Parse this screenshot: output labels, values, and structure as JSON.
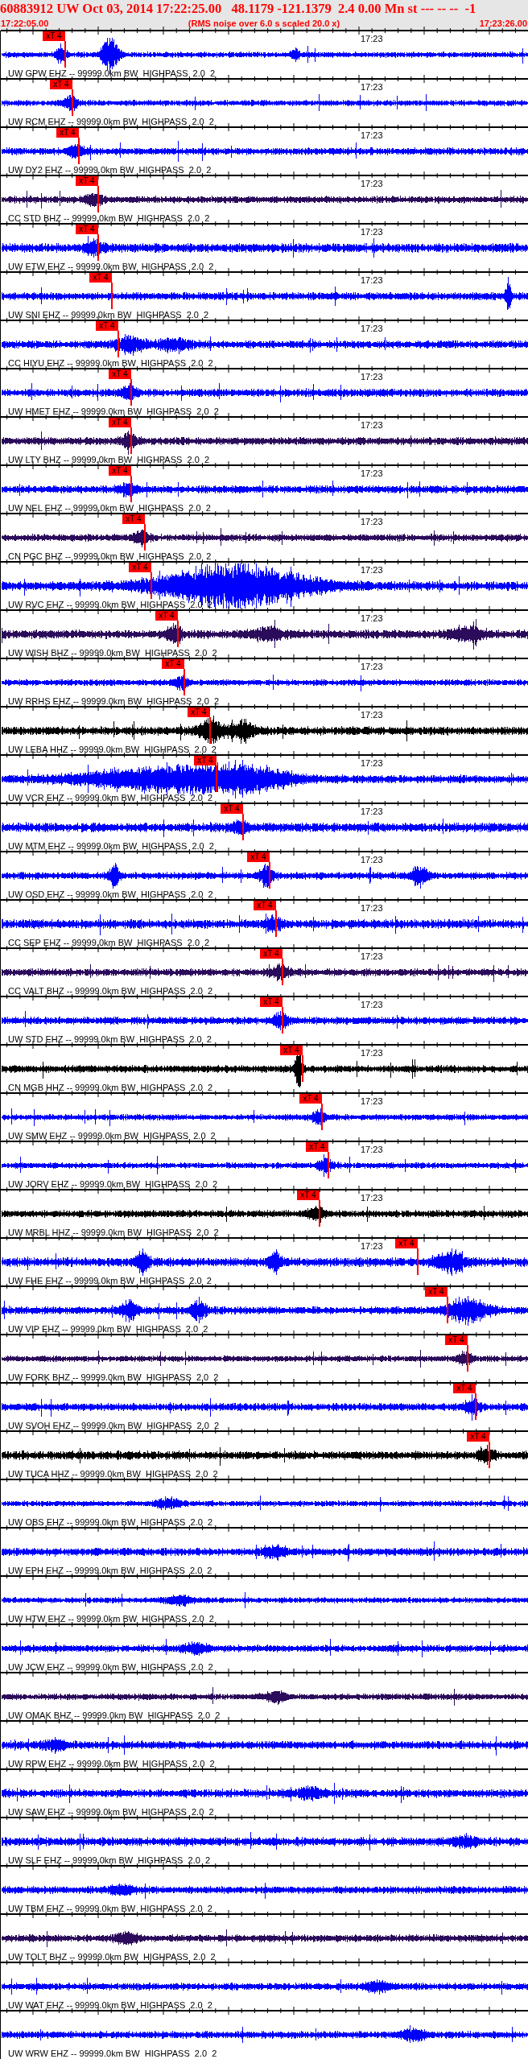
{
  "header": {
    "title": "60883912 UW Oct 03, 2014 17:22:25.00   48.1179 -121.1379  2.4 0.00 Mn st --- -- --  -1",
    "start_time": "17:22:05.00",
    "note": "(RMS noise over 6.0 s scaled 20.0 x)",
    "end_time": "17:23:26.00"
  },
  "channels": [
    {
      "label": "UW GPW EHZ -- 99999.0km BW  HIGHPASS  2.0  2",
      "color": "#0000ff",
      "time_mark": "17:23",
      "pick": "xT 4"
    },
    {
      "label": "UW RCM EHZ -- 99999.0km BW  HIGHPASS  2.0  2",
      "color": "#0000ff",
      "time_mark": "17:23",
      "pick": "xT 4"
    },
    {
      "label": "UW DY2 EHZ -- 99999.0km BW  HIGHPASS  2.0  2",
      "color": "#0000ff",
      "time_mark": "17:23",
      "pick": "xT 4"
    },
    {
      "label": "CC STD BHZ -- 99999.0km BW  HIGHPASS  2.0  2",
      "color": "#2b0b5b",
      "time_mark": "17:23",
      "pick": "xT 4"
    },
    {
      "label": "UW ETW EHZ -- 99999.0km BW  HIGHPASS  2.0  2",
      "color": "#0000ff",
      "time_mark": "17:23",
      "pick": "xT 4"
    },
    {
      "label": "UW SNI EHZ -- 99999.0km BW  HIGHPASS  2.0  2",
      "color": "#0000ff",
      "time_mark": "17:23",
      "pick": "xT 4"
    },
    {
      "label": "CC HIYU EHZ -- 99999.0km BW  HIGHPASS  2.0  2",
      "color": "#0000ff",
      "time_mark": "17:23",
      "pick": "xT 4"
    },
    {
      "label": "UW HMET EHZ -- 99999.0km BW  HIGHPASS  2.0  2",
      "color": "#0000ff",
      "time_mark": "17:23",
      "pick": "xT 4"
    },
    {
      "label": "UW LTY BHZ -- 99999.0km BW  HIGHPASS  2.0  2",
      "color": "#2b0b5b",
      "time_mark": "17:23",
      "pick": "xT 4"
    },
    {
      "label": "UW NEL EHZ -- 99999.0km BW  HIGHPASS  2.0  2",
      "color": "#0000ff",
      "time_mark": "17:23",
      "pick": "xT 4"
    },
    {
      "label": "CN PGC BHZ -- 99999.0km BW  HIGHPASS  2.0  2",
      "color": "#2b0b5b",
      "time_mark": "17:23",
      "pick": "xT 4"
    },
    {
      "label": "UW RVC EHZ -- 99999.0km BW  HIGHPASS  2.0  2",
      "color": "#0000ff",
      "time_mark": "17:23",
      "pick": "xT 4"
    },
    {
      "label": "UW WISH BHZ -- 99999.0km BW  HIGHPASS  2.0  2",
      "color": "#2b0b5b",
      "time_mark": "17:23",
      "pick": "xT 4"
    },
    {
      "label": "UW RRHS EHZ -- 99999.0km BW  HIGHPASS  2.0  2",
      "color": "#0000ff",
      "time_mark": "17:23",
      "pick": "xT 4"
    },
    {
      "label": "UW LEBA HHZ -- 99999.0km BW  HIGHPASS  2.0  2",
      "color": "#000000",
      "time_mark": "17:23",
      "pick": "xT 4"
    },
    {
      "label": "UW VCR EHZ -- 99999.0km BW  HIGHPASS  2.0  2",
      "color": "#0000ff",
      "time_mark": "17:23",
      "pick": "xT 4"
    },
    {
      "label": "UW MTM EHZ -- 99999.0km BW  HIGHPASS  2.0  2",
      "color": "#0000ff",
      "time_mark": "17:23",
      "pick": "xT 4"
    },
    {
      "label": "UW OSD EHZ -- 99999.0km BW  HIGHPASS  2.0  2",
      "color": "#0000ff",
      "time_mark": "17:23",
      "pick": "xT 4"
    },
    {
      "label": "CC SEP EHZ -- 99999.0km BW  HIGHPASS  2.0  2",
      "color": "#0000ff",
      "time_mark": "17:23",
      "pick": "xT 4"
    },
    {
      "label": "CC VALT BHZ -- 99999.0km BW  HIGHPASS  2.0  2",
      "color": "#2b0b5b",
      "time_mark": "17:23",
      "pick": "xT 4"
    },
    {
      "label": "UW STD EHZ -- 99999.0km BW  HIGHPASS  2.0  2",
      "color": "#0000ff",
      "time_mark": "17:23",
      "pick": "xT 4"
    },
    {
      "label": "CN MGB HHZ -- 99999.0km BW  HIGHPASS  2.0  2",
      "color": "#000000",
      "time_mark": "17:23",
      "pick": "xT 4"
    },
    {
      "label": "UW SMW EHZ -- 99999.0km BW  HIGHPASS  2.0  2",
      "color": "#0000ff",
      "time_mark": "17:23",
      "pick": "xT 4"
    },
    {
      "label": "UW JORV EHZ -- 99999.0km BW  HIGHPASS  2.0  2",
      "color": "#0000ff",
      "time_mark": "17:23",
      "pick": "xT 4"
    },
    {
      "label": "UW MRBL HHZ -- 99999.0km BW  HIGHPASS  2.0  2",
      "color": "#000000",
      "time_mark": "17:23",
      "pick": "xT 4"
    },
    {
      "label": "UW FHE EHZ -- 99999.0km BW  HIGHPASS  2.0  2",
      "color": "#0000ff",
      "time_mark": "17:23",
      "pick": "xT 4"
    },
    {
      "label": "UW VIP EHZ -- 99999.0km BW  HIGHPASS  2.0  2",
      "color": "#0000ff",
      "pick": "xT 4"
    },
    {
      "label": "UW FORK BHZ -- 99999.0km BW  HIGHPASS  2.0  2",
      "color": "#2b0b5b",
      "pick": "xT 4"
    },
    {
      "label": "UW SVOH EHZ -- 99999.0km BW  HIGHPASS  2.0  2",
      "color": "#0000ff",
      "pick": "xT 4"
    },
    {
      "label": "UW TUCA HHZ -- 99999.0km BW  HIGHPASS  2.0  2",
      "color": "#000000",
      "pick": "xT 4"
    },
    {
      "label": "UW OBS EHZ -- 99999.0km BW  HIGHPASS  2.0  2",
      "color": "#0000ff"
    },
    {
      "label": "UW EPH EHZ -- 99999.0km BW  HIGHPASS  2.0  2",
      "color": "#0000ff"
    },
    {
      "label": "UW HTW EHZ -- 99999.0km BW  HIGHPASS  2.0  2",
      "color": "#0000ff"
    },
    {
      "label": "UW JCW EHZ -- 99999.0km BW  HIGHPASS  2.0  2",
      "color": "#0000ff"
    },
    {
      "label": "UW OMAK BHZ -- 99999.0km BW  HIGHPASS  2.0  2",
      "color": "#2b0b5b"
    },
    {
      "label": "UW RPW EHZ -- 99999.0km BW  HIGHPASS  2.0  2",
      "color": "#0000ff"
    },
    {
      "label": "UW SAW EHZ -- 99999.0km BW  HIGHPASS  2.0  2",
      "color": "#0000ff"
    },
    {
      "label": "UW SLF EHZ -- 99999.0km BW  HIGHPASS  2.0  2",
      "color": "#0000ff"
    },
    {
      "label": "UW TBM EHZ -- 99999.0km BW  HIGHPASS  2.0  2",
      "color": "#0000ff"
    },
    {
      "label": "UW TOLT BHZ -- 99999.0km BW  HIGHPASS  2.0  2",
      "color": "#2b0b5b"
    },
    {
      "label": "UW WAT EHZ -- 99999.0km BW  HIGHPASS  2.0  2",
      "color": "#0000ff"
    },
    {
      "label": "UW WRW EHZ -- 99999.0km BW  HIGHPASS  2.0  2",
      "color": "#0000ff"
    }
  ]
}
